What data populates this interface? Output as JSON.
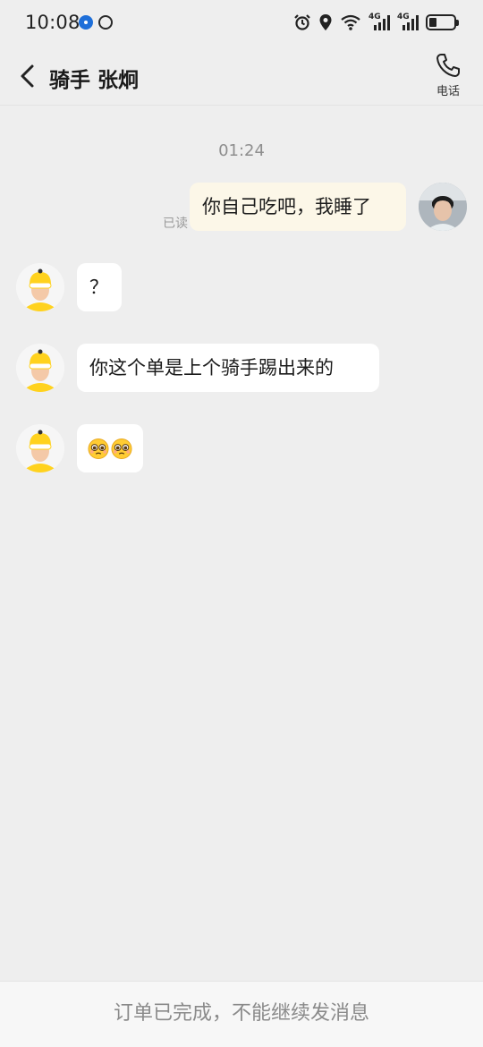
{
  "status_bar": {
    "time": "10:08",
    "network_label_1": "4G",
    "network_label_2": "4G"
  },
  "header": {
    "title": "骑手 张炯",
    "phone_label": "电话"
  },
  "chat": {
    "time_separator": "01:24",
    "messages": [
      {
        "sender": "me",
        "text": "你自己吃吧，我睡了",
        "status": "已读"
      },
      {
        "sender": "rider",
        "text": "？"
      },
      {
        "sender": "rider",
        "text": "你这个单是上个骑手踢出来的"
      },
      {
        "sender": "rider",
        "text": "",
        "emoji": "pleading-face-emoji x2"
      }
    ]
  },
  "footer": {
    "notice": "订单已完成，不能继续发消息"
  },
  "colors": {
    "background": "#eeeeee",
    "my_bubble": "#fcf7e8",
    "their_bubble": "#ffffff",
    "rider_avatar_accent": "#ffd21e"
  }
}
